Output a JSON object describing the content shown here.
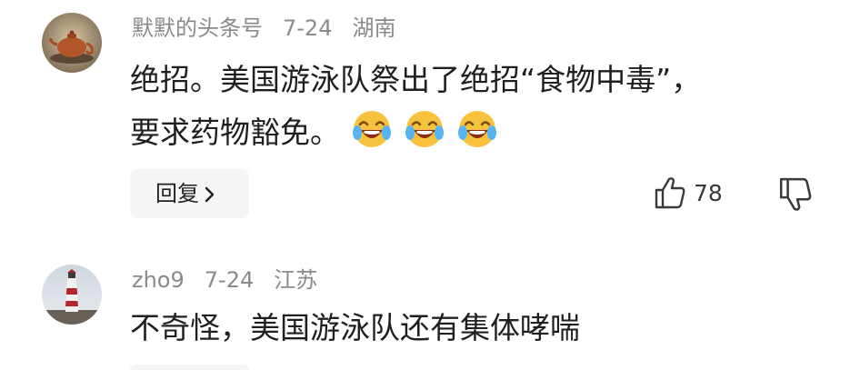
{
  "comments": [
    {
      "username": "默默的头条号",
      "date": "7-24",
      "location": "湖南",
      "text_line1": "绝招。美国游泳队祭出了绝招“食物中毒”，",
      "text_line2": "要求药物豁免。",
      "emojis": [
        "laugh-cry-emoji",
        "laugh-cry-emoji",
        "laugh-cry-emoji"
      ],
      "reply_label": "回复",
      "like_count": "78",
      "avatar": "teapot-avatar"
    },
    {
      "username": "zho9",
      "date": "7-24",
      "location": "江苏",
      "text": "不奇怪，美国游泳队还有集体哮喘",
      "avatar": "lighthouse-avatar"
    }
  ],
  "colors": {
    "meta_gray": "#8a8a8a",
    "text": "#1f1f1f",
    "reply_bg": "#f5f5f5"
  }
}
